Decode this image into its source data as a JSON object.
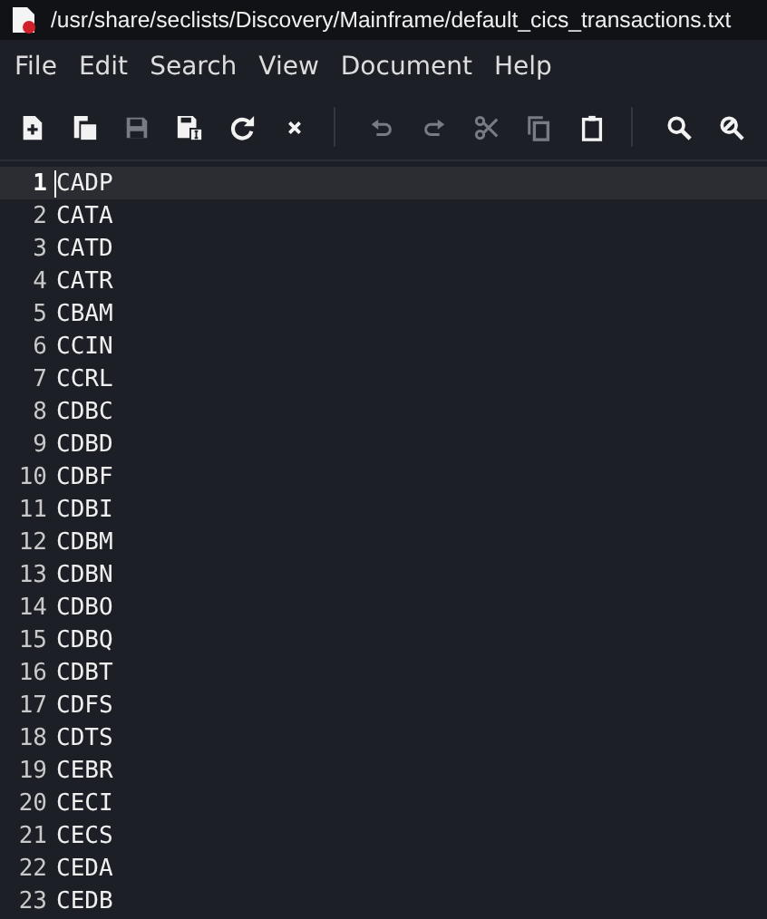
{
  "window": {
    "title": "/usr/share/seclists/Discovery/Mainframe/default_cics_transactions.txt"
  },
  "menu": [
    "File",
    "Edit",
    "Search",
    "View",
    "Document",
    "Help"
  ],
  "toolbar": [
    {
      "kind": "new",
      "disabled": false
    },
    {
      "kind": "open",
      "disabled": false
    },
    {
      "kind": "save",
      "disabled": true
    },
    {
      "kind": "saveas",
      "disabled": false
    },
    {
      "kind": "reload",
      "disabled": false
    },
    {
      "kind": "close",
      "disabled": false
    },
    {
      "kind": "sep"
    },
    {
      "kind": "undo",
      "disabled": true
    },
    {
      "kind": "redo",
      "disabled": true
    },
    {
      "kind": "cut",
      "disabled": true
    },
    {
      "kind": "copy",
      "disabled": true
    },
    {
      "kind": "paste",
      "disabled": false
    },
    {
      "kind": "sep"
    },
    {
      "kind": "search",
      "disabled": false
    },
    {
      "kind": "replace",
      "disabled": false
    }
  ],
  "lines": [
    {
      "number": "1",
      "text": "CADP",
      "selected": true
    },
    {
      "number": "2",
      "text": "CATA",
      "selected": false
    },
    {
      "number": "3",
      "text": "CATD",
      "selected": false
    },
    {
      "number": "4",
      "text": "CATR",
      "selected": false
    },
    {
      "number": "5",
      "text": "CBAM",
      "selected": false
    },
    {
      "number": "6",
      "text": "CCIN",
      "selected": false
    },
    {
      "number": "7",
      "text": "CCRL",
      "selected": false
    },
    {
      "number": "8",
      "text": "CDBC",
      "selected": false
    },
    {
      "number": "9",
      "text": "CDBD",
      "selected": false
    },
    {
      "number": "10",
      "text": "CDBF",
      "selected": false
    },
    {
      "number": "11",
      "text": "CDBI",
      "selected": false
    },
    {
      "number": "12",
      "text": "CDBM",
      "selected": false
    },
    {
      "number": "13",
      "text": "CDBN",
      "selected": false
    },
    {
      "number": "14",
      "text": "CDBO",
      "selected": false
    },
    {
      "number": "15",
      "text": "CDBQ",
      "selected": false
    },
    {
      "number": "16",
      "text": "CDBT",
      "selected": false
    },
    {
      "number": "17",
      "text": "CDFS",
      "selected": false
    },
    {
      "number": "18",
      "text": "CDTS",
      "selected": false
    },
    {
      "number": "19",
      "text": "CEBR",
      "selected": false
    },
    {
      "number": "20",
      "text": "CECI",
      "selected": false
    },
    {
      "number": "21",
      "text": "CECS",
      "selected": false
    },
    {
      "number": "22",
      "text": "CEDA",
      "selected": false
    },
    {
      "number": "23",
      "text": "CEDB",
      "selected": false
    }
  ]
}
